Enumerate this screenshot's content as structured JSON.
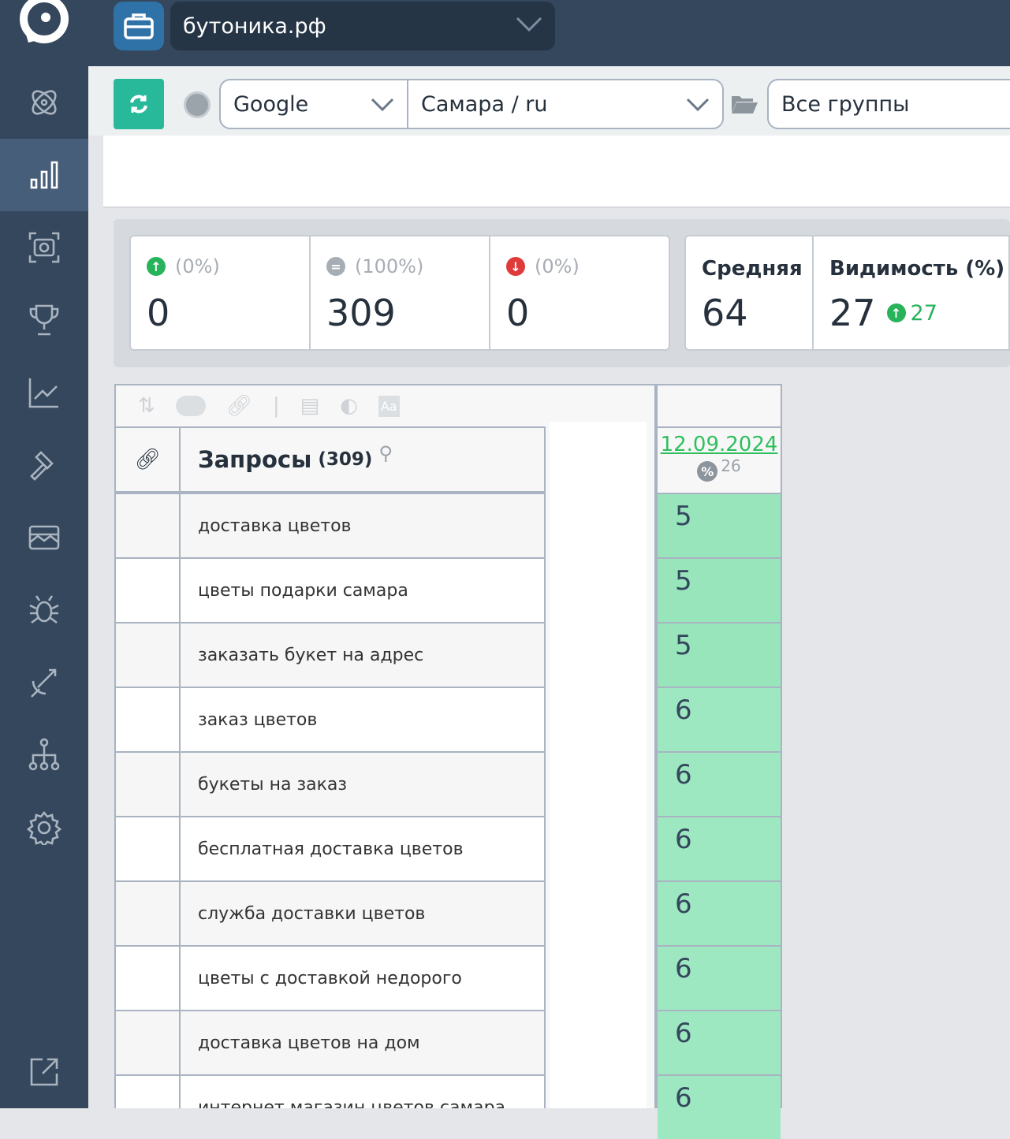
{
  "header": {
    "project": "бутоника.рф"
  },
  "sidebar": {
    "items": [
      {
        "icon": "atom-icon",
        "active": false
      },
      {
        "icon": "bar-chart-icon",
        "active": true
      },
      {
        "icon": "camera-scan-icon",
        "active": false
      },
      {
        "icon": "trophy-icon",
        "active": false
      },
      {
        "icon": "line-chart-icon",
        "active": false
      },
      {
        "icon": "gavel-icon",
        "active": false
      },
      {
        "icon": "picture-icon",
        "active": false
      },
      {
        "icon": "bug-icon",
        "active": false
      },
      {
        "icon": "satellite-icon",
        "active": false
      },
      {
        "icon": "sitemap-icon",
        "active": false
      },
      {
        "icon": "gear-icon",
        "active": false
      },
      {
        "icon": "external-link-icon",
        "active": false
      }
    ]
  },
  "toolbar": {
    "engine": "Google",
    "region": "Самара / ru",
    "groups": "Все группы"
  },
  "stats": {
    "up": {
      "pct": "(0%)",
      "value": "0"
    },
    "same": {
      "pct": "(100%)",
      "value": "309"
    },
    "down": {
      "pct": "(0%)",
      "value": "0"
    },
    "avg": {
      "label": "Средняя",
      "value": "64"
    },
    "visibility": {
      "label": "Видимость (%)",
      "value": "27",
      "delta": "27"
    }
  },
  "colors": {
    "up": "#27b35a",
    "down": "#e03b3b",
    "neutral": "#a7adb4",
    "cell": "#9ae5bd",
    "accent": "#27b99a"
  },
  "table": {
    "header": {
      "title": "Запросы",
      "count": "(309)"
    },
    "date": {
      "label": "12.09.2024",
      "pct": "26"
    },
    "rows": [
      {
        "query": "доставка цветов",
        "pos": "5"
      },
      {
        "query": "цветы подарки самара",
        "pos": "5"
      },
      {
        "query": "заказать букет на адрес",
        "pos": "5"
      },
      {
        "query": "заказ цветов",
        "pos": "6"
      },
      {
        "query": "букеты на заказ",
        "pos": "6"
      },
      {
        "query": "бесплатная доставка цветов",
        "pos": "6"
      },
      {
        "query": "служба доставки цветов",
        "pos": "6"
      },
      {
        "query": "цветы с доставкой недорого",
        "pos": "6"
      },
      {
        "query": "доставка цветов на дом",
        "pos": "6"
      },
      {
        "query": "интернет магазин цветов самара",
        "pos": "6"
      }
    ]
  }
}
